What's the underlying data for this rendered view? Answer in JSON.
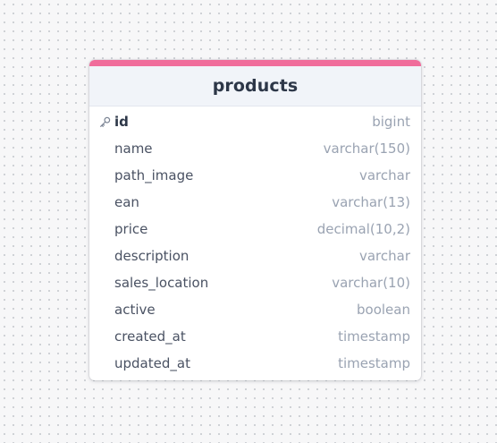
{
  "table": {
    "name": "products",
    "accent_color": "#f06c9b",
    "key_icon": "key-icon",
    "columns": [
      {
        "name": "id",
        "type": "bigint",
        "primary_key": true
      },
      {
        "name": "name",
        "type": "varchar(150)",
        "primary_key": false
      },
      {
        "name": "path_image",
        "type": "varchar",
        "primary_key": false
      },
      {
        "name": "ean",
        "type": "varchar(13)",
        "primary_key": false
      },
      {
        "name": "price",
        "type": "decimal(10,2)",
        "primary_key": false
      },
      {
        "name": "description",
        "type": "varchar",
        "primary_key": false
      },
      {
        "name": "sales_location",
        "type": "varchar(10)",
        "primary_key": false
      },
      {
        "name": "active",
        "type": "boolean",
        "primary_key": false
      },
      {
        "name": "created_at",
        "type": "timestamp",
        "primary_key": false
      },
      {
        "name": "updated_at",
        "type": "timestamp",
        "primary_key": false
      }
    ]
  }
}
